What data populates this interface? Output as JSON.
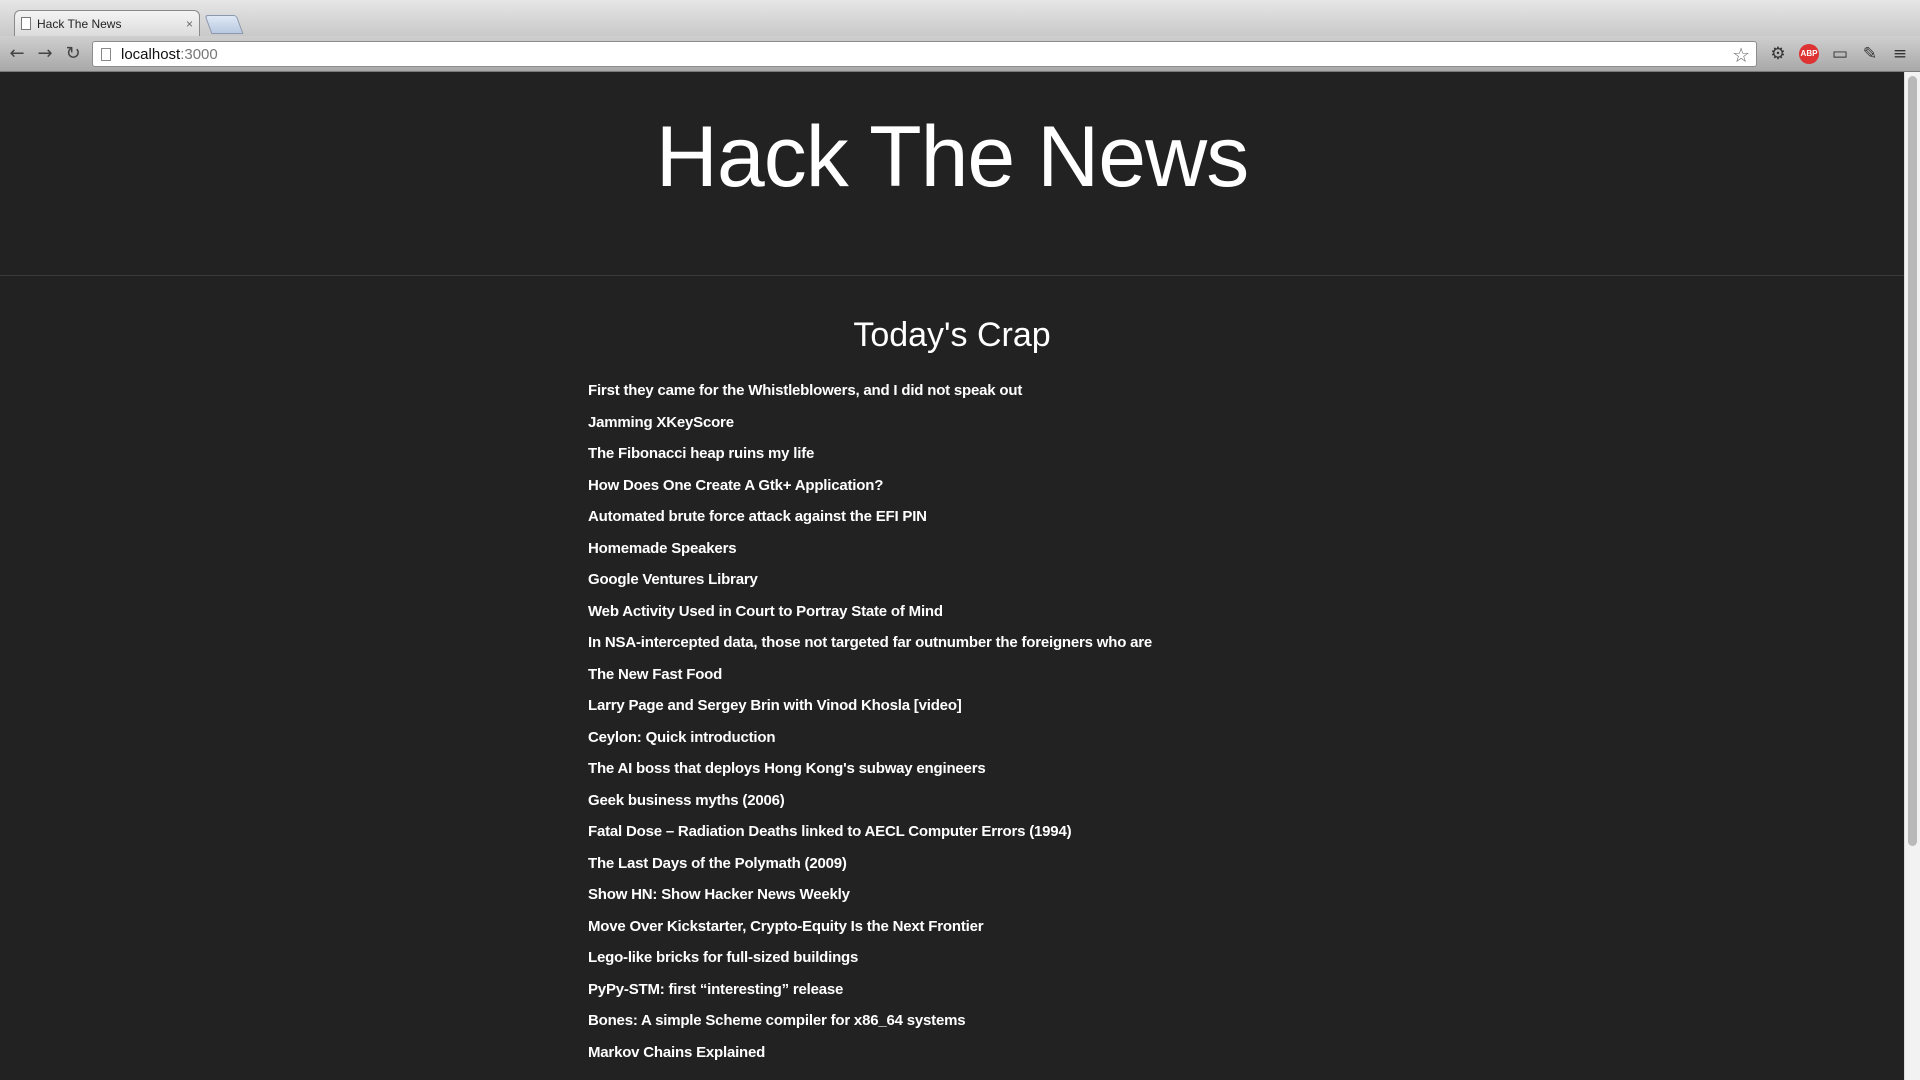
{
  "browser": {
    "tab_title": "Hack The News",
    "tab_close": "×",
    "url_host": "localhost",
    "url_port": ":3000",
    "back_icon": "←",
    "forward_icon": "→",
    "reload_icon": "↻",
    "star_icon": "☆",
    "settings_icon": "⚙",
    "abp_label": "ABP",
    "cast_icon": "▭",
    "dropper_icon": "✎",
    "menu_icon": "≡"
  },
  "site": {
    "title": "Hack The News",
    "section_title": "Today's Crap"
  },
  "news": [
    "First they came for the Whistleblowers, and I did not speak out",
    "Jamming XKeyScore",
    "The Fibonacci heap ruins my life",
    "How Does One Create A Gtk+ Application?",
    "Automated brute force attack against the EFI PIN",
    "Homemade Speakers",
    "Google Ventures Library",
    "Web Activity Used in Court to Portray State of Mind",
    "In NSA-intercepted data, those not targeted far outnumber the foreigners who are",
    "The New Fast Food",
    "Larry Page and Sergey Brin with Vinod Khosla [video]",
    "Ceylon: Quick introduction",
    "The AI boss that deploys Hong Kong's subway engineers",
    "Geek business myths (2006)",
    "Fatal Dose – Radiation Deaths linked to AECL Computer Errors (1994)",
    "The Last Days of the Polymath (2009)",
    "Show HN: Show Hacker News Weekly",
    "Move Over Kickstarter, Crypto-Equity Is the Next Frontier",
    "Lego-like bricks for full-sized buildings",
    "PyPy-STM: first “interesting” release",
    "Bones: A simple Scheme compiler for x86_64 systems",
    "Markov Chains Explained"
  ]
}
